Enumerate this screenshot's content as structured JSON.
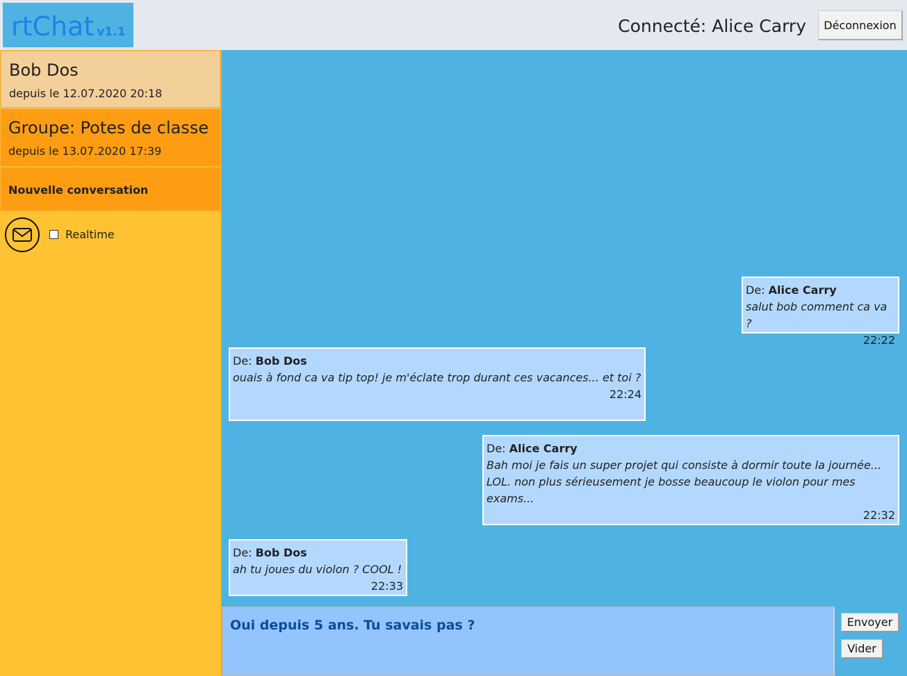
{
  "header": {
    "logo_text": "rtChat",
    "logo_version": "v1.1",
    "connected_label": "Connecté: Alice Carry",
    "logout_label": "Déconnexion"
  },
  "sidebar": {
    "conversations": [
      {
        "title": "Bob Dos",
        "since": "depuis le 12.07.2020 20:18"
      },
      {
        "title": "Groupe: Potes de classe",
        "since": "depuis le 13.07.2020 17:39"
      }
    ],
    "new_conversation_label": "Nouvelle conversation",
    "realtime_label": "Realtime",
    "realtime_checked": false
  },
  "chat": {
    "from_prefix": "De:",
    "messages": [
      {
        "from": "Alice Carry",
        "body": "salut bob comment ca va ?",
        "time": "22:22",
        "side": "right"
      },
      {
        "from": "Bob Dos",
        "body": "ouais à fond ca va tip top! je m'éclate trop durant ces vacances... et toi ?",
        "time": "22:24",
        "side": "left"
      },
      {
        "from": "Alice Carry",
        "body": "Bah moi je fais un super projet qui consiste à dormir toute la journée... LOL. non plus sérieusement je bosse beaucoup le violon pour mes exams...",
        "time": "22:32",
        "side": "right"
      },
      {
        "from": "Bob Dos",
        "body": "ah tu joues du violon ? COOL !",
        "time": "22:33",
        "side": "left"
      }
    ]
  },
  "compose": {
    "value": "Oui depuis 5 ans. Tu savais pas ?",
    "send_label": "Envoyer",
    "clear_label": "Vider"
  },
  "colors": {
    "logo_bg": "#4eb3e3",
    "logo_text": "#1e82e6",
    "sidebar_bg": "#ffc233",
    "active_conv_bg": "#f3cf9a",
    "conv_bg": "#ff9d12",
    "chat_bg": "#4eb3e3",
    "message_bg": "#b3d8fd",
    "compose_bg": "#93c4fd",
    "compose_text": "#0a4c9a"
  },
  "icons": {
    "mail": "envelope-icon"
  }
}
